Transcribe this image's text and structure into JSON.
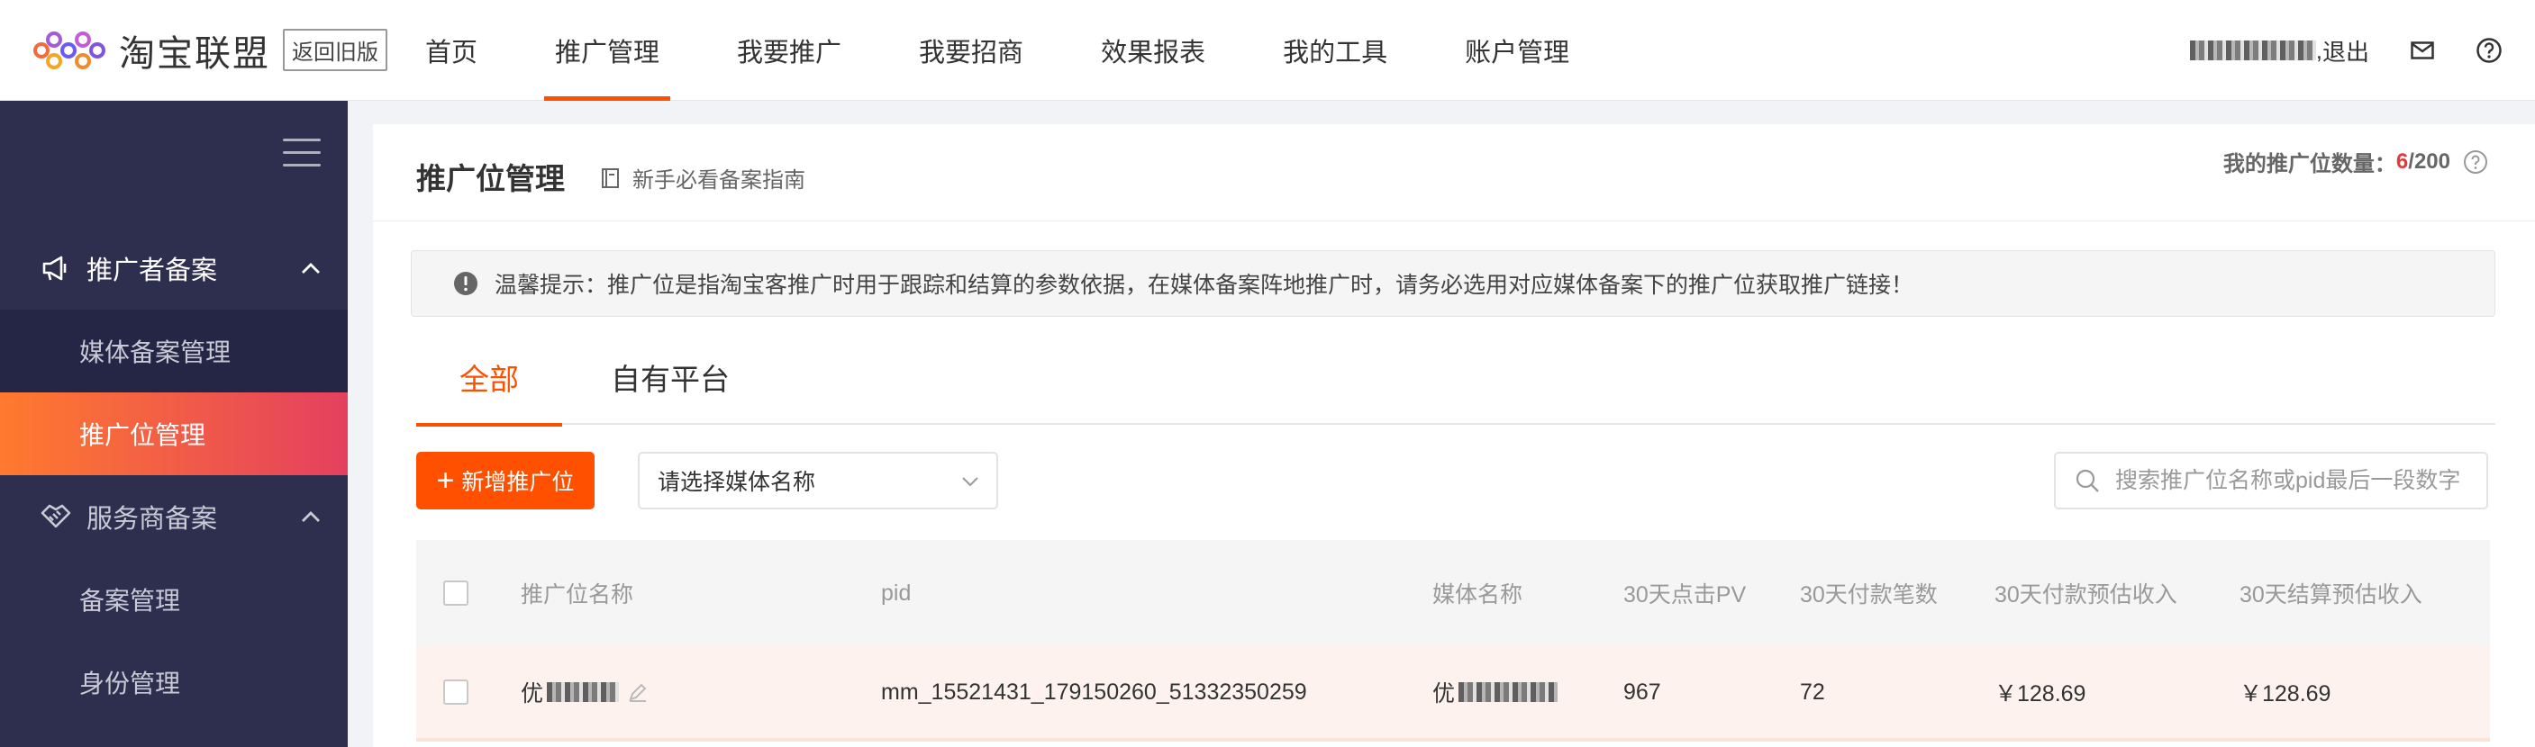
{
  "header": {
    "brand": "淘宝联盟",
    "old_version": "返回旧版",
    "nav": [
      "首页",
      "推广管理",
      "我要推广",
      "我要招商",
      "效果报表",
      "我的工具",
      "账户管理"
    ],
    "active_nav": "推广管理",
    "logout": "退出",
    "username_suffix": ", ",
    "icons": [
      "mail-icon",
      "help-icon"
    ]
  },
  "sidebar": {
    "groups": [
      {
        "label": "推广者备案",
        "icon": "megaphone-icon"
      },
      {
        "label": "服务商备案",
        "icon": "handshake-icon"
      }
    ],
    "items": [
      "媒体备案管理",
      "推广位管理",
      "备案管理",
      "身份管理"
    ],
    "active_item": "推广位管理"
  },
  "page": {
    "title": "推广位管理",
    "guide_link": "新手必看备案指南",
    "quota_label": "我的推广位数量：",
    "quota_used": "6",
    "quota_total": "/200",
    "notice": "温馨提示：推广位是指淘宝客推广时用于跟踪和结算的参数依据，在媒体备案阵地推广时，请务必选用对应媒体备案下的推广位获取推广链接！",
    "tabs": [
      "全部",
      "自有平台"
    ],
    "active_tab": "全部",
    "add_button": "新增推广位",
    "media_select": "请选择媒体名称",
    "search_placeholder": "搜索推广位名称或pid最后一段数字"
  },
  "table": {
    "columns": [
      "推广位名称",
      "pid",
      "媒体名称",
      "30天点击PV",
      "30天付款笔数",
      "30天付款预估收入",
      "30天结算预估收入"
    ],
    "rows": [
      {
        "name": "优",
        "pid": "mm_15521431_179150260_51332350259",
        "media": "优",
        "pv": "967",
        "orders": "72",
        "pay_income": "￥128.69",
        "settle_income": "￥128.69"
      }
    ]
  },
  "colors": {
    "accent": "#ff5000",
    "sidebar_bg": "#2e2e4f",
    "sidebar_active_start": "#ff7a2e",
    "sidebar_active_end": "#e4405f",
    "quota_highlight": "#e4393c"
  }
}
